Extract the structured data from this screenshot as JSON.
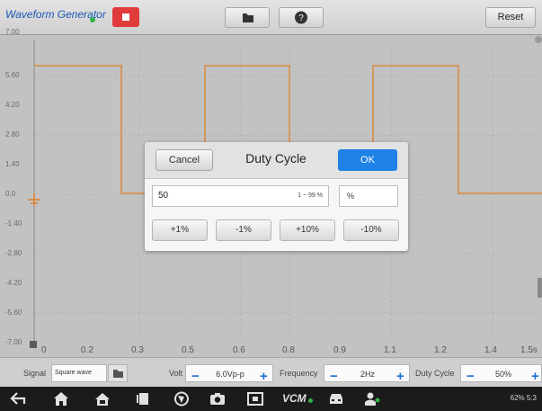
{
  "app": {
    "title": "Waveform Generator",
    "reset_label": "Reset",
    "icons": {
      "stop": "stop-icon",
      "folder": "folder-icon",
      "help": "help-icon"
    }
  },
  "plot": {
    "y_ticks": [
      "7.00",
      "5.60",
      "4.20",
      "2.80",
      "1.40",
      "0.0",
      "-1.40",
      "-2.80",
      "-4.20",
      "-5.60",
      "-7.00"
    ],
    "x_ticks": [
      "0",
      "0.2",
      "0.3",
      "0.5",
      "0.6",
      "0.8",
      "0.9",
      "1.1",
      "1.2",
      "1.4",
      "1.5s"
    ],
    "wave_color": "#e0802a"
  },
  "dialog": {
    "cancel_label": "Cancel",
    "title": "Duty Cycle",
    "ok_label": "OK",
    "value": "50",
    "range_hint": "1 ~ 99 %",
    "unit": "%",
    "steps": [
      "+1%",
      "-1%",
      "+10%",
      "-10%"
    ]
  },
  "controls": {
    "signal_label": "Signal",
    "signal_value": "Square wave",
    "volt_label": "Volt",
    "volt_value": "6.0Vp-p",
    "frequency_label": "Frequency",
    "frequency_value": "2Hz",
    "duty_label": "Duty Cycle",
    "duty_value": "50%",
    "minus": "−",
    "plus": "+"
  },
  "navbar": {
    "icons": [
      "back-icon",
      "home-icon",
      "vci-home-icon",
      "recent-apps-icon",
      "browser-icon",
      "camera-icon",
      "screenshot-icon",
      "vcm-icon",
      "car-icon",
      "mechanic-icon"
    ],
    "vcm_label": "VCM",
    "status": "62% 5:3"
  }
}
